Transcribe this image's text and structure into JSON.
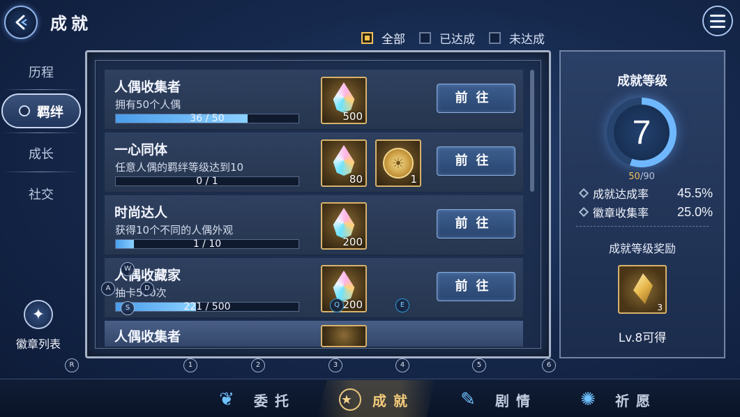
{
  "header": {
    "title": "成就"
  },
  "filters": [
    {
      "label": "全部",
      "checked": true
    },
    {
      "label": "已达成",
      "checked": false
    },
    {
      "label": "未达成",
      "checked": false
    }
  ],
  "nav": {
    "items": [
      "历程",
      "羁绊",
      "成长",
      "社交"
    ],
    "active": "羁绊",
    "badge_list_label": "徽章列表"
  },
  "achievements": [
    {
      "title": "人偶收集者",
      "desc": "拥有50个人偶",
      "progress_text": "36 / 50",
      "progress": 0.72,
      "rewards": [
        {
          "icon": "rainbow-gem-icon",
          "qty": "500"
        }
      ],
      "button": "前往"
    },
    {
      "title": "一心同体",
      "desc": "任意人偶的羁绊等级达到10",
      "progress_text": "0 / 1",
      "progress": 0.0,
      "rewards": [
        {
          "icon": "rainbow-gem-icon",
          "qty": "80"
        },
        {
          "icon": "gold-coin-icon",
          "qty": "1"
        }
      ],
      "button": "前往"
    },
    {
      "title": "时尚达人",
      "desc": "获得10个不同的人偶外观",
      "progress_text": "1 / 10",
      "progress": 0.1,
      "rewards": [
        {
          "icon": "rainbow-gem-icon",
          "qty": "200"
        }
      ],
      "button": "前往"
    },
    {
      "title": "人偶收藏家",
      "desc": "抽卡500次",
      "progress_text": "221 / 500",
      "progress": 0.44,
      "rewards": [
        {
          "icon": "rainbow-gem-icon",
          "qty": "200"
        }
      ],
      "button": "前往"
    },
    {
      "title": "人偶收集者"
    }
  ],
  "level_panel": {
    "title": "成就等级",
    "level": "7",
    "exp_current": "50",
    "exp_total": "/90",
    "exp_fraction": 0.556,
    "stats": [
      {
        "label": "成就达成率",
        "value": "45.5%"
      },
      {
        "label": "徽章收集率",
        "value": "25.0%"
      }
    ],
    "reward_title": "成就等级奖励",
    "reward_qty": "3",
    "reward_unlock": "Lv.8可得"
  },
  "key_hints": [
    "W",
    "A",
    "S",
    "D",
    "Q",
    "E",
    "R",
    "1",
    "2",
    "3",
    "4",
    "5",
    "6"
  ],
  "bottom_tabs": [
    {
      "label": "委托",
      "icon": "feather-icon",
      "active": false
    },
    {
      "label": "成就",
      "icon": "medal-icon",
      "active": true
    },
    {
      "label": "剧情",
      "icon": "quill-icon",
      "active": false
    },
    {
      "label": "祈愿",
      "icon": "star-burst-icon",
      "active": false
    }
  ]
}
